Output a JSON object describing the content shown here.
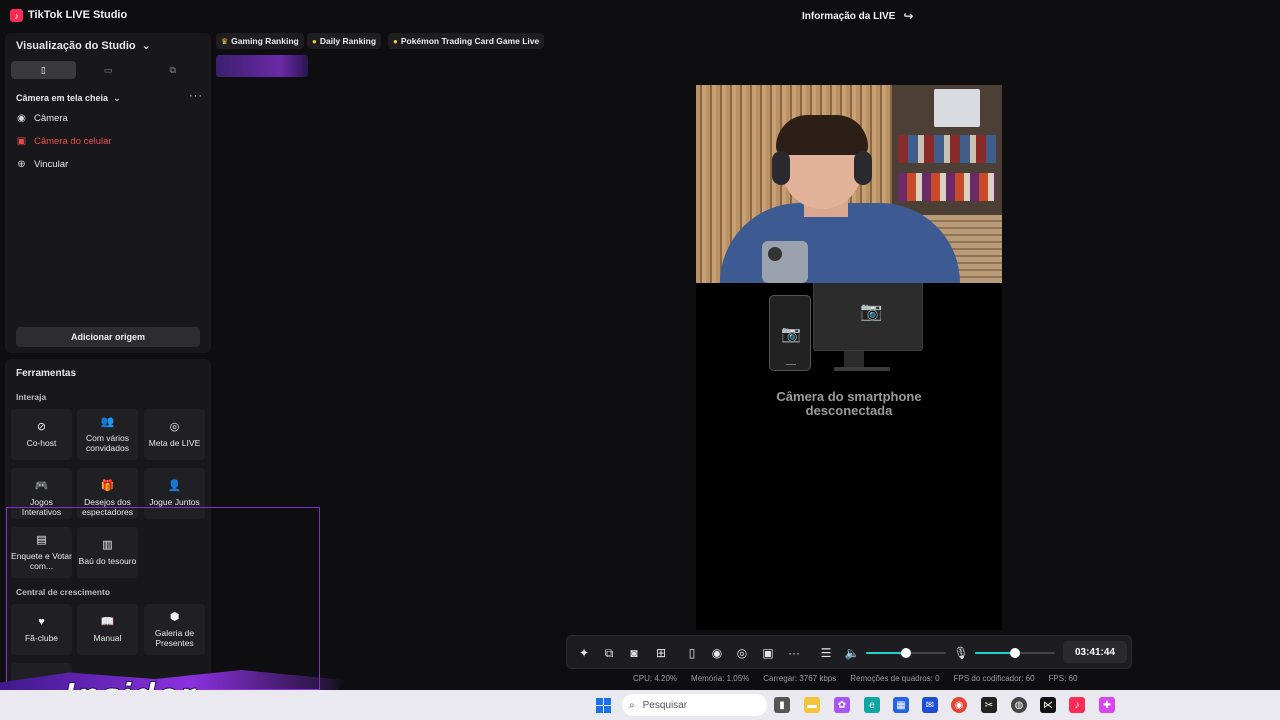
{
  "titlebar": {
    "app_title": "TikTok LIVE Studio",
    "live_info": "Informação da LIVE"
  },
  "studio": {
    "view_label": "Visualização do Studio",
    "scene_label": "Câmera em tela cheia",
    "sources": [
      {
        "label": "Câmera",
        "icon": "camera-icon"
      },
      {
        "label": "Câmera do celular",
        "icon": "phone-camera-icon",
        "active": true
      },
      {
        "label": "Vincular",
        "icon": "globe-icon"
      }
    ],
    "add_origin": "Adicionar origem"
  },
  "tools": {
    "title": "Ferramentas",
    "section_interaja": "Interaja",
    "section_growth": "Central de crescimento",
    "interaja": [
      {
        "label": "Co-host",
        "icon": "link-icon"
      },
      {
        "label": "Com vários convidados",
        "icon": "users-icon"
      },
      {
        "label": "Meta de LIVE",
        "icon": "target-icon"
      },
      {
        "label": "Jogos Interativos",
        "icon": "gamepad-icon"
      },
      {
        "label": "Desejos dos espectadores",
        "icon": "gift-icon"
      },
      {
        "label": "Jogue Juntos",
        "icon": "user-play-icon"
      },
      {
        "label": "Enquete e Votar com...",
        "icon": "poll-icon"
      },
      {
        "label": "Baú do tesouro",
        "icon": "chest-icon"
      }
    ],
    "growth": [
      {
        "label": "Fã-clube",
        "icon": "heart-icon"
      },
      {
        "label": "Manual",
        "icon": "book-icon"
      },
      {
        "label": "Galeria de Presentes",
        "icon": "gallery-icon"
      }
    ]
  },
  "chips": [
    {
      "label": "Gaming Ranking",
      "icon": "crown-icon",
      "color": "#f5c842"
    },
    {
      "label": "Daily Ranking",
      "icon": "medal-icon",
      "color": "#f5c842"
    },
    {
      "label": "Pokémon Trading Card Game Live",
      "icon": "coin-icon",
      "color": "#f5c842"
    }
  ],
  "preview": {
    "disconnected_line1": "Câmera do smartphone",
    "disconnected_line2": "desconectada"
  },
  "controls": {
    "volume_level": 0.5,
    "mic_level": 0.5,
    "timer": "03:41:44"
  },
  "stats": {
    "cpu": "CPU: 4.20%",
    "memory": "Memória: 1.05%",
    "upload": "Carregar: 3767 kbps",
    "dropped": "Remoções de quadros: 0",
    "encoder_fps": "FPS do codificador: 60",
    "fps": "FPS: 60"
  },
  "overlay": {
    "brand": "Insider"
  },
  "taskbar": {
    "search_placeholder": "Pesquisar"
  },
  "colors": {
    "accent": "#20d5c4",
    "tiktok": "#fe2c55",
    "overlay_purple": "#7b2fd8",
    "source_active": "#e94b4b"
  }
}
